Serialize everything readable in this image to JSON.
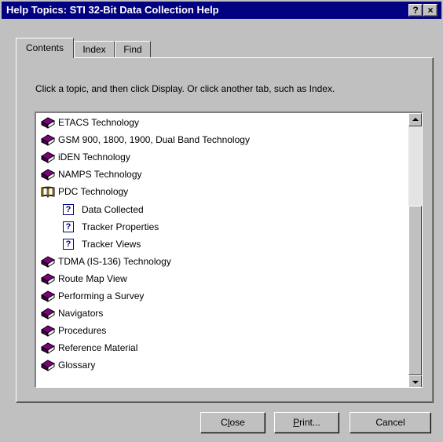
{
  "window": {
    "title": "Help Topics: STI 32-Bit Data Collection Help",
    "help_button": "?",
    "close_button": "×"
  },
  "tabs": [
    {
      "label": "Contents",
      "active": true
    },
    {
      "label": "Index",
      "active": false
    },
    {
      "label": "Find",
      "active": false
    }
  ],
  "instruction": "Click a topic, and then click Display. Or click another tab, such as Index.",
  "topics": [
    {
      "label": "ETACS Technology",
      "icon": "closed-book-icon"
    },
    {
      "label": "GSM 900, 1800, 1900, Dual Band Technology",
      "icon": "closed-book-icon"
    },
    {
      "label": "iDEN Technology",
      "icon": "closed-book-icon"
    },
    {
      "label": "NAMPS Technology",
      "icon": "closed-book-icon"
    },
    {
      "label": "PDC Technology",
      "icon": "open-book-icon"
    },
    {
      "label": "Data Collected",
      "icon": "help-page-icon"
    },
    {
      "label": "Tracker Properties",
      "icon": "help-page-icon"
    },
    {
      "label": "Tracker Views",
      "icon": "help-page-icon"
    },
    {
      "label": "TDMA (IS-136) Technology",
      "icon": "closed-book-icon"
    },
    {
      "label": "Route Map View",
      "icon": "closed-book-icon"
    },
    {
      "label": "Performing a Survey",
      "icon": "closed-book-icon"
    },
    {
      "label": "Navigators",
      "icon": "closed-book-icon"
    },
    {
      "label": "Procedures",
      "icon": "closed-book-icon"
    },
    {
      "label": "Reference Material",
      "icon": "closed-book-icon"
    },
    {
      "label": "Glossary",
      "icon": "closed-book-icon"
    }
  ],
  "buttons": {
    "close_first": "C",
    "close_accel": "l",
    "close_rest": "ose",
    "print_accel": "P",
    "print_rest": "rint...",
    "cancel": "Cancel"
  },
  "colors": {
    "title_bar": "#000080",
    "face": "#c0c0c0",
    "book": "#800080"
  }
}
